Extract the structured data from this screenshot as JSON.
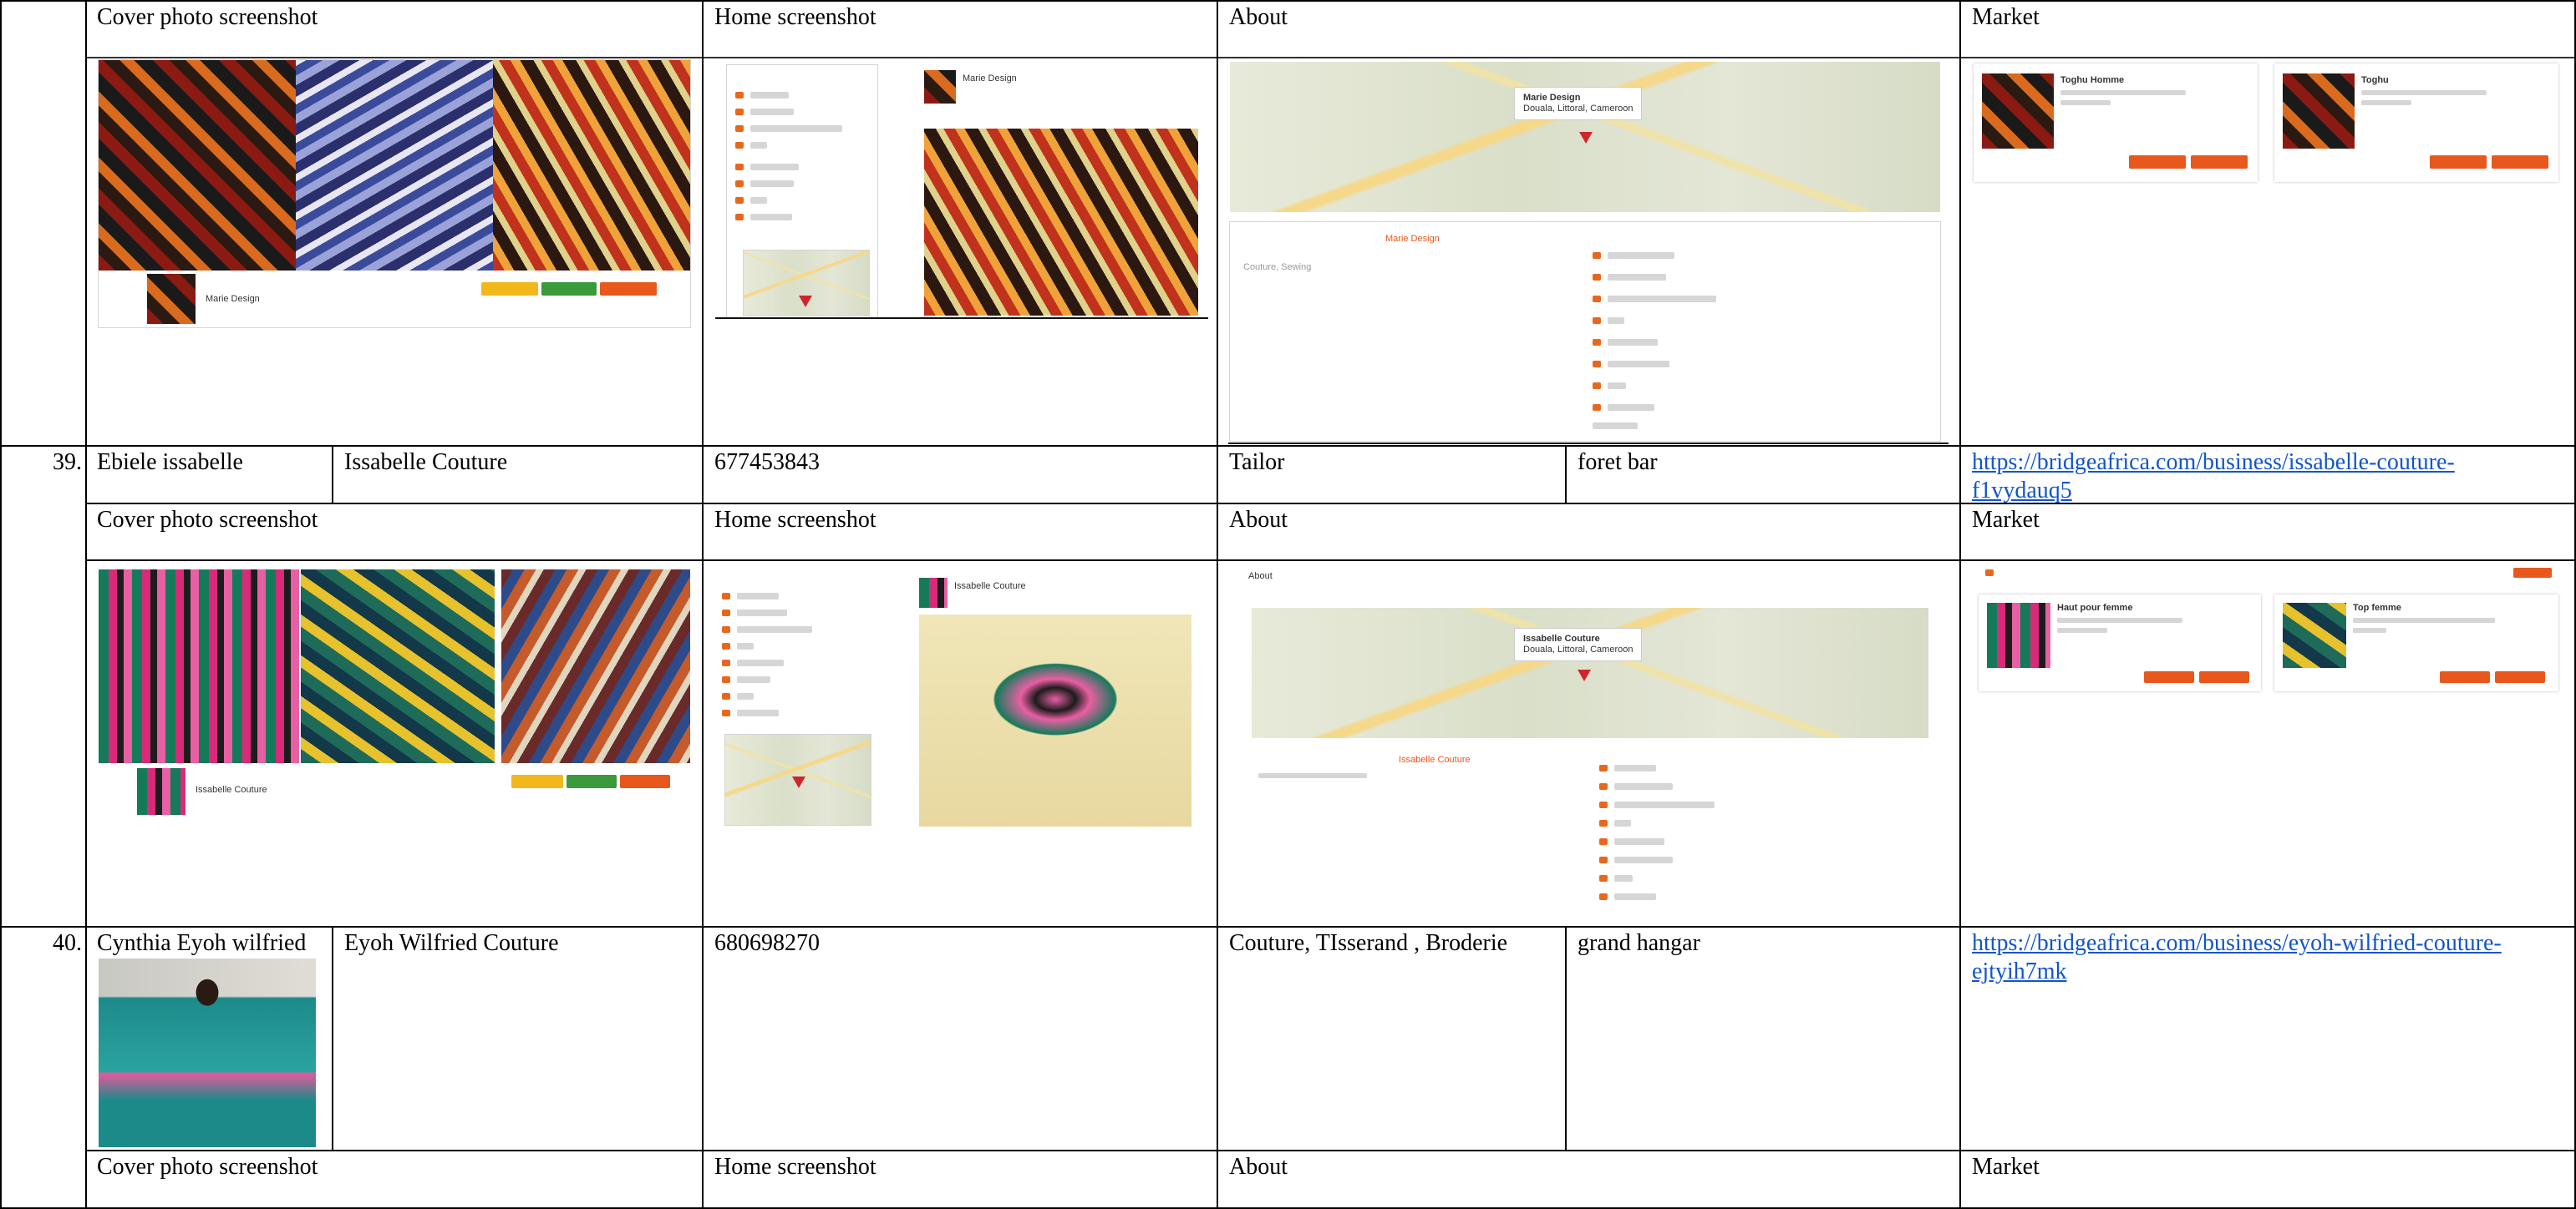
{
  "section_headers": {
    "cover": "Cover photo screenshot",
    "home": "Home screenshot",
    "about": "About",
    "market": "Market"
  },
  "rows": [
    {
      "number": "39.",
      "owner": "Ebiele issabelle",
      "business": "Issabelle Couture",
      "phone": "677453843",
      "category": "Tailor",
      "location": "foret bar",
      "url": "https://bridgeafrica.com/business/issabelle-couture-f1vydauq5",
      "url_line1": "https://bridgeafrica.com/business/issabelle-couture-",
      "url_line2": "f1vydauq5"
    },
    {
      "number": "40.",
      "owner": "Cynthia Eyoh wilfried",
      "business": "Eyoh Wilfried Couture",
      "phone": "680698270",
      "category": "Couture, TIsserand , Broderie",
      "location": "grand hangar",
      "url": "https://bridgeafrica.com/business/eyoh-wilfried-couture-ejtyih7mk",
      "url_line1": "https://bridgeafrica.com/business/eyoh-wilfried-couture-",
      "url_line2": "ejtyih7mk"
    }
  ],
  "screens": {
    "top": {
      "profile_name": "Marie Design",
      "map_card_title": "Marie Design",
      "map_card_address": "Douala, Littoral, Cameroon",
      "market_products": [
        "Toghu Homme",
        "Toghu"
      ],
      "about_business": "Marie Design",
      "about_sub": "Couture, Sewing"
    },
    "middle": {
      "profile_name": "Issabelle Couture",
      "map_card_title": "Issabelle Couture",
      "map_card_address": "Douala, Littoral, Cameroon",
      "about_header": "About",
      "market_products": [
        "Haut pour femme",
        "Top femme"
      ],
      "about_business": "Issabelle Couture"
    }
  },
  "colors": {
    "accent": "#e8571b",
    "link": "#1155cc",
    "border": "#000000"
  }
}
